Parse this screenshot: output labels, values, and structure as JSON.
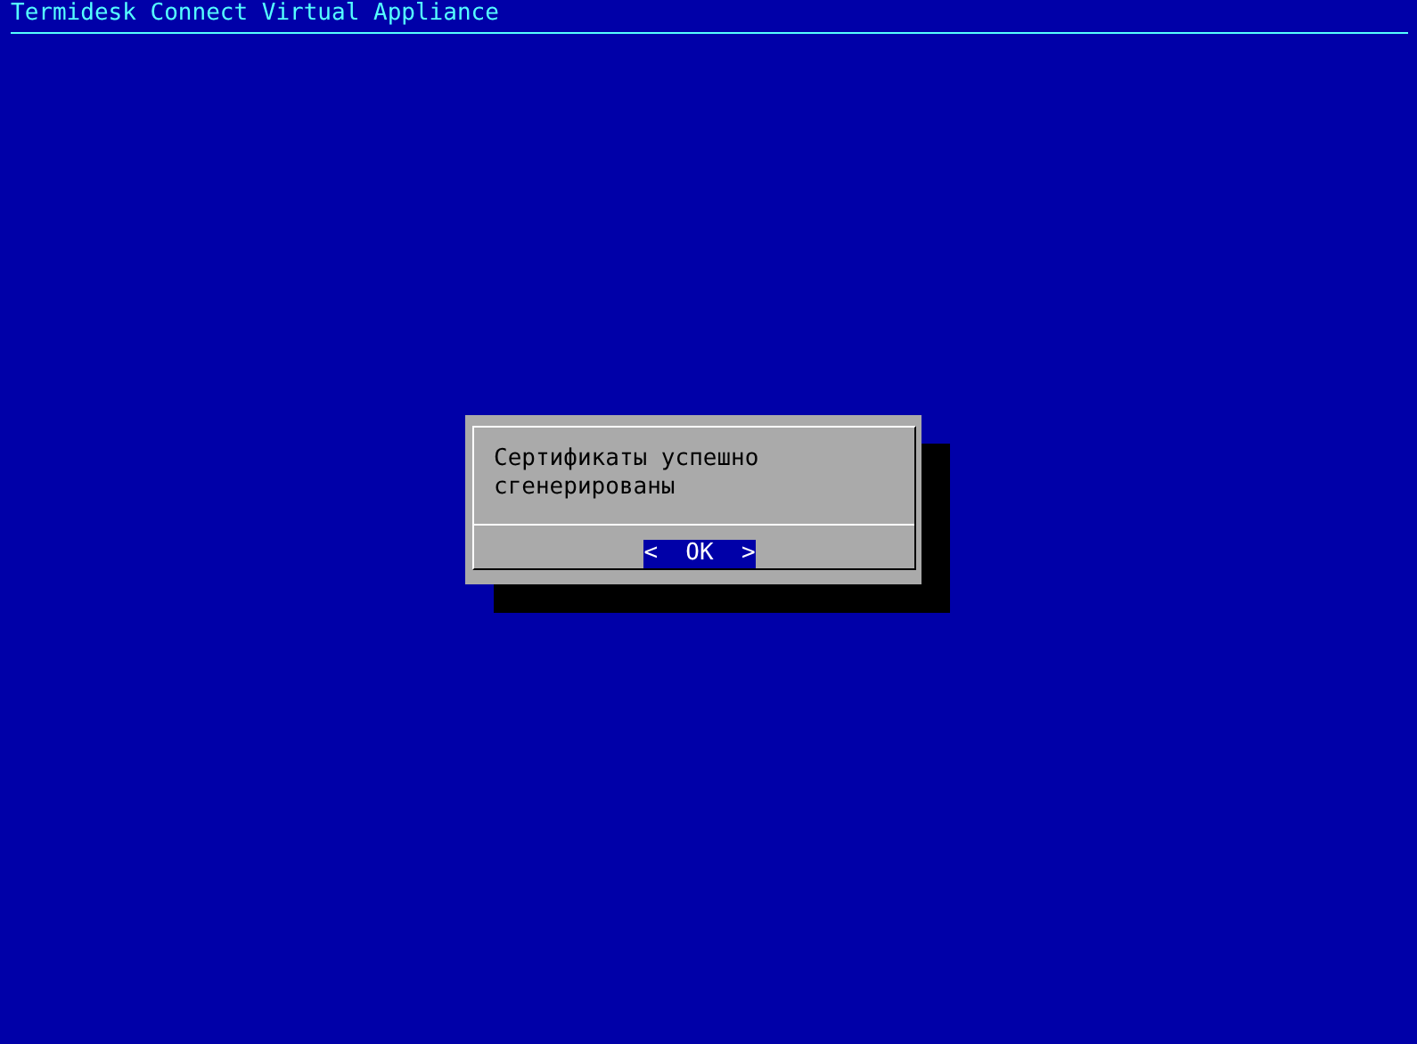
{
  "window": {
    "title": "Termidesk Connect Virtual Appliance"
  },
  "dialog": {
    "message": "Сертификаты успешно сгенерированы",
    "buttons": [
      {
        "label": "<  OK  >",
        "selected": true
      }
    ]
  }
}
